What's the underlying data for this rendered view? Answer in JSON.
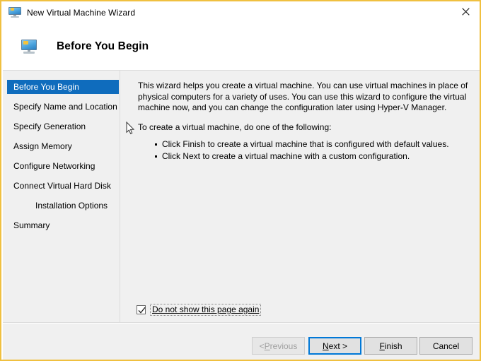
{
  "window": {
    "title": "New Virtual Machine Wizard",
    "title_icon": "monitor-icon",
    "close_icon": "close-icon",
    "border_color": "#f0c040"
  },
  "header": {
    "title": "Before You Begin",
    "icon": "monitor-icon"
  },
  "sidebar": {
    "accent_color": "#0f6cbd",
    "items": [
      {
        "label": "Before You Begin",
        "selected": true,
        "sub": false
      },
      {
        "label": "Specify Name and Location",
        "selected": false,
        "sub": false
      },
      {
        "label": "Specify Generation",
        "selected": false,
        "sub": false
      },
      {
        "label": "Assign Memory",
        "selected": false,
        "sub": false
      },
      {
        "label": "Configure Networking",
        "selected": false,
        "sub": false
      },
      {
        "label": "Connect Virtual Hard Disk",
        "selected": false,
        "sub": false
      },
      {
        "label": "Installation Options",
        "selected": false,
        "sub": true
      },
      {
        "label": "Summary",
        "selected": false,
        "sub": false
      }
    ]
  },
  "content": {
    "paragraph1": "This wizard helps you create a virtual machine. You can use virtual machines in place of physical computers for a variety of uses. You can use this wizard to configure the virtual machine now, and you can change the configuration later using Hyper-V Manager.",
    "paragraph2": "To create a virtual machine, do one of the following:",
    "bullets": [
      "Click Finish to create a virtual machine that is configured with default values.",
      "Click Next to create a virtual machine with a custom configuration."
    ]
  },
  "checkbox": {
    "label": "Do not show this page again",
    "checked": true
  },
  "footer": {
    "buttons": [
      {
        "label_pre": "< ",
        "label_mnemonic": "P",
        "label_post": "revious",
        "state": "disabled"
      },
      {
        "label_pre": "",
        "label_mnemonic": "N",
        "label_post": "ext >",
        "state": "focused"
      },
      {
        "label_pre": "",
        "label_mnemonic": "F",
        "label_post": "inish",
        "state": "normal"
      },
      {
        "label_pre": "",
        "label_mnemonic": "",
        "label_post": "Cancel",
        "state": "normal"
      }
    ],
    "focus_color": "#0078d7"
  }
}
